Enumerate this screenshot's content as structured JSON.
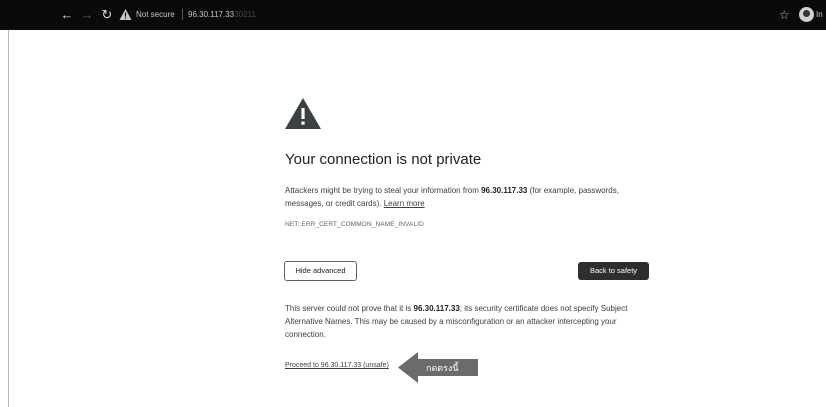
{
  "toolbar": {
    "back_icon": "back-arrow-icon",
    "forward_icon": "forward-arrow-icon",
    "reload_icon": "reload-icon",
    "security_label": "Not secure",
    "host": "96.30.117.33",
    "port": ":30211",
    "bookmark_icon": "star-icon",
    "profile_initials": "In"
  },
  "interstitial": {
    "title": "Your connection is not private",
    "p1_pre": "Attackers might be trying to steal your information from ",
    "p1_host": "96.30.117.33",
    "p1_post": " (for example, passwords, messages, or credit cards). ",
    "learn_more": "Learn more",
    "error_code": "NET::ERR_CERT_COMMON_NAME_INVALID",
    "hide_advanced": "Hide advanced",
    "back_to_safety": "Back to safety",
    "p2_pre": "This server could not prove that it is ",
    "p2_host": "96.30.117.33",
    "p2_post": "; its security certificate does not specify Subject Alternative Names. This may be caused by a misconfiguration or an attacker intercepting your connection.",
    "proceed_link": "Proceed to 96.30.117.33 (unsafe)"
  },
  "annotation": {
    "arrow_label": "กดตรงนี้",
    "arrow_color": "#6b6b6b"
  },
  "colors": {
    "toolbar_bg": "#0a0a0a",
    "primary_button": "#2e2e2e"
  }
}
